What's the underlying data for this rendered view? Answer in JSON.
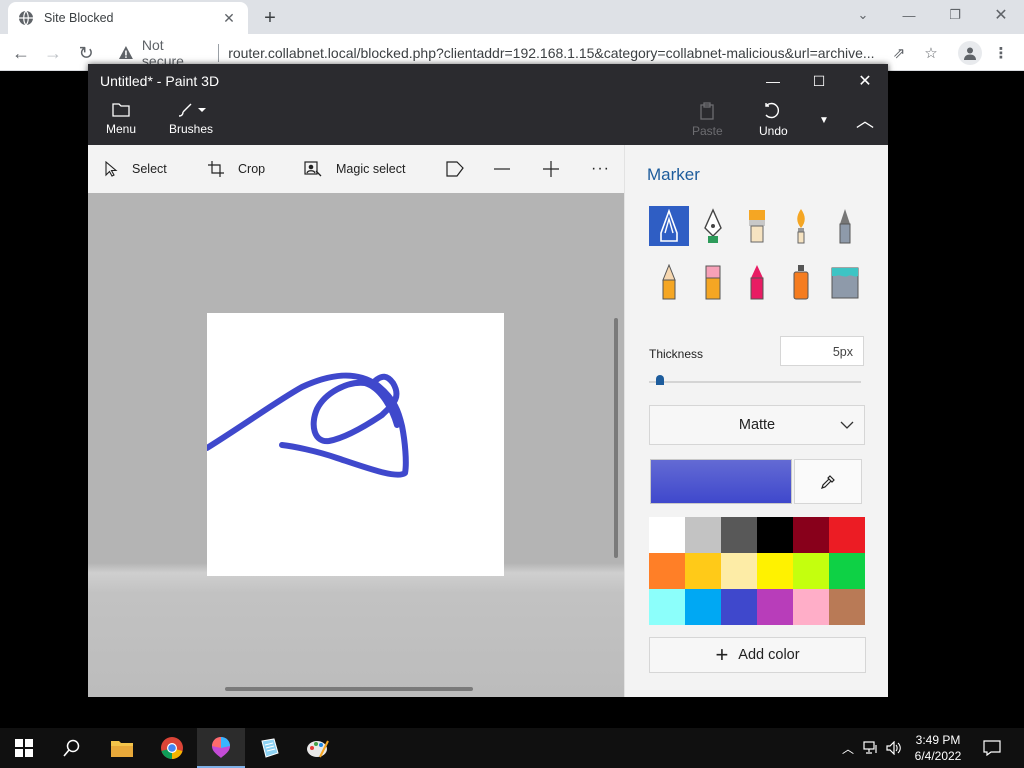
{
  "browser": {
    "tab_title": "Site Blocked",
    "not_secure": "Not secure",
    "url": "router.collabnet.local/blocked.php?clientaddr=192.168.1.15&category=collabnet-malicious&url=archive..."
  },
  "window": {
    "title": "Untitled* - Paint 3D"
  },
  "ribbon": {
    "menu": "Menu",
    "brushes": "Brushes",
    "paste": "Paste",
    "undo": "Undo"
  },
  "toolbar": {
    "select": "Select",
    "crop": "Crop",
    "magic_select": "Magic select"
  },
  "panel": {
    "title": "Marker",
    "thickness_label": "Thickness",
    "thickness_value": "5px",
    "thickness_fraction": 0.05,
    "finish": "Matte",
    "add_color": "Add color",
    "selected_color": "#3f48cc",
    "palette": [
      "#ffffff",
      "#c3c3c3",
      "#585858",
      "#000000",
      "#88001b",
      "#ec1c24",
      "#ff7f27",
      "#ffca18",
      "#fdeca6",
      "#fff200",
      "#c4ff0e",
      "#0ed145",
      "#8cfffb",
      "#00a8f3",
      "#3f48cc",
      "#b83dba",
      "#ffaec8",
      "#b97a56"
    ]
  },
  "clock": {
    "time": "3:49 PM",
    "date": "6/4/2022"
  },
  "icons": [
    "globe-icon",
    "warning-icon",
    "folder-icon",
    "brush-icon",
    "paste-icon",
    "undo-icon",
    "eyedropper-icon",
    "windows-start-icon",
    "search-icon",
    "file-explorer-icon",
    "chrome-icon",
    "paint-3d-icon",
    "notepad-icon",
    "paint-icon"
  ]
}
